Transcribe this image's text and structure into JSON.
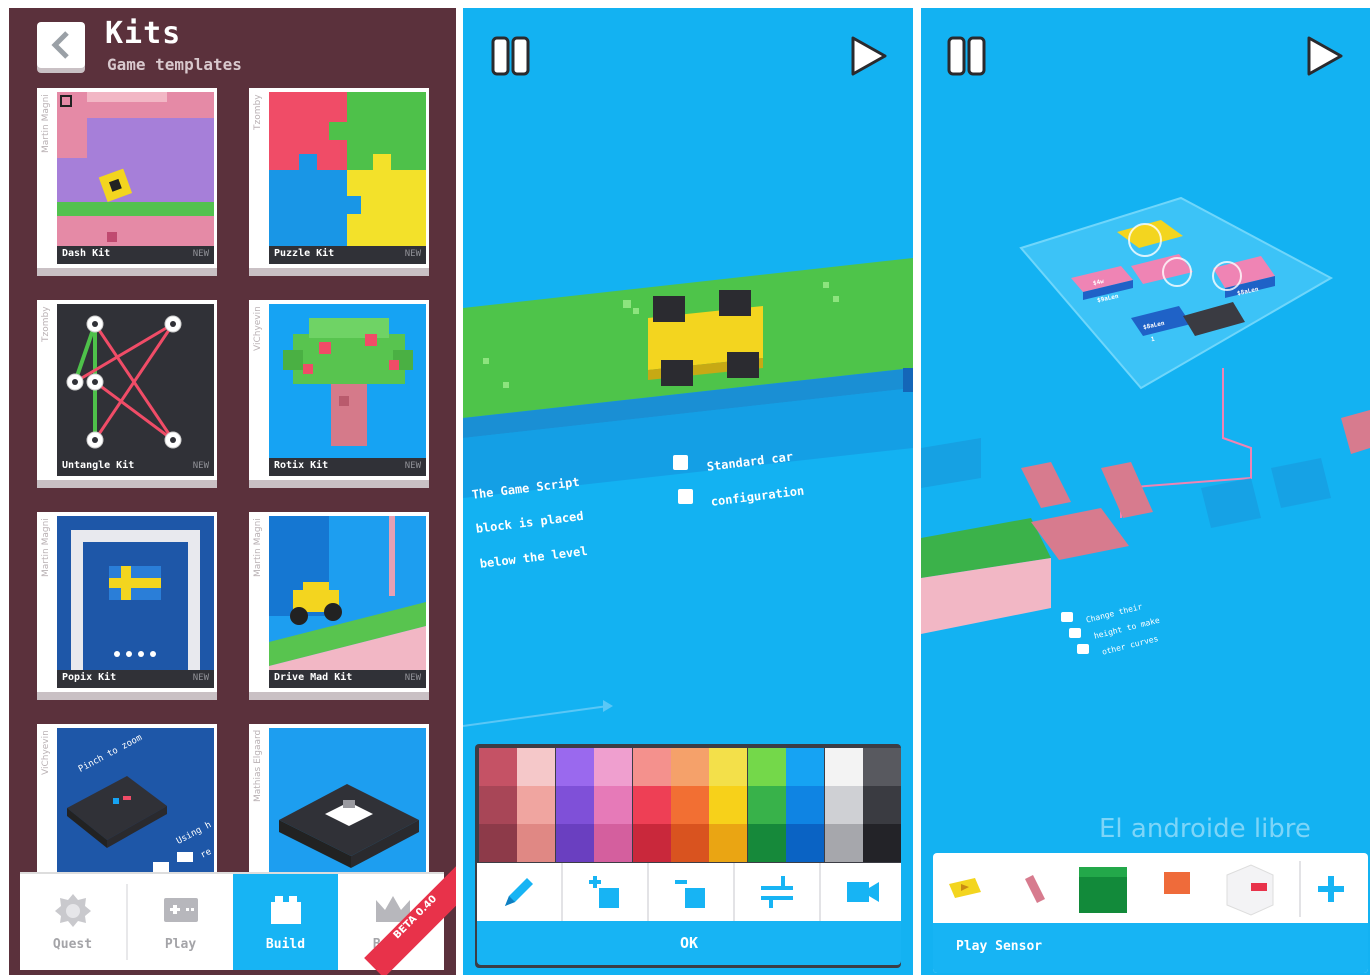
{
  "kits_screen": {
    "title": "Kits",
    "subtitle": "Game templates",
    "cards": [
      {
        "name": "Dash Kit",
        "author": "Martin Magni",
        "badge": "NEW"
      },
      {
        "name": "Puzzle Kit",
        "author": "Tzomby",
        "badge": "NEW"
      },
      {
        "name": "Untangle Kit",
        "author": "Tzomby",
        "badge": "NEW"
      },
      {
        "name": "Rotix Kit",
        "author": "ViChyevin",
        "badge": "NEW"
      },
      {
        "name": "Popix Kit",
        "author": "Martin Magni",
        "badge": "NEW"
      },
      {
        "name": "Drive Mad Kit",
        "author": "Martin Magni",
        "badge": "NEW"
      },
      {
        "name": "",
        "author": "ViChyevin",
        "badge": "",
        "overlay_text": "Pinch to zoom",
        "overlay_text_2": "Using h",
        "overlay_text_3": "re"
      },
      {
        "name": "",
        "author": "Mathias Elgaard",
        "badge": ""
      }
    ],
    "tabs": [
      {
        "label": "Quest",
        "icon": "quest-icon",
        "active": false
      },
      {
        "label": "Play",
        "icon": "gamepad-icon",
        "active": false
      },
      {
        "label": "Build",
        "icon": "block-icon",
        "active": true
      },
      {
        "label": "Boost",
        "icon": "crown-icon",
        "active": false
      }
    ],
    "beta_ribbon": "BETA 0.40"
  },
  "editor_screen": {
    "caption_left": [
      "The Game Script",
      "block is placed",
      "below the level"
    ],
    "caption_right": [
      "Standard car",
      "configuration"
    ],
    "ok_label": "OK",
    "palette_colors": [
      [
        "#c55265",
        "#f5c8c9",
        "#9a69ee",
        "#ef9fcf",
        "#f4918d",
        "#f5a16a",
        "#f3e04a",
        "#74d84a",
        "#16a3f3",
        "#f3f3f3",
        "#58595f"
      ],
      [
        "#a84657",
        "#f0a5a0",
        "#7f50d8",
        "#e67ab8",
        "#ee3f55",
        "#f26f33",
        "#f7d11a",
        "#38b24a",
        "#0f84e3",
        "#cfd0d4",
        "#3a3b41"
      ],
      [
        "#8d3a49",
        "#e08884",
        "#6a3fc0",
        "#d45f9e",
        "#c9283b",
        "#d9531f",
        "#eaa513",
        "#16893a",
        "#0a63c4",
        "#a6a7ac",
        "#232328"
      ]
    ],
    "tools": [
      "pencil-icon",
      "add-block-icon",
      "remove-block-icon",
      "swap-icon",
      "camera-icon"
    ]
  },
  "logic_screen": {
    "caption": [
      "Change their",
      "height to make",
      "other curves"
    ],
    "node_labels": [
      "$4w",
      "$9aLen",
      "$8aLen",
      "1",
      "$8aLen"
    ],
    "bottom_label": "Play Sensor",
    "watermark": "El androide libre",
    "items": [
      "play-sensor-icon",
      "pink-block-icon",
      "green-block-icon",
      "orange-block-icon",
      "white-block-icon",
      "plus-icon"
    ]
  },
  "colors": {
    "sky": "#13b2f2",
    "kits_bg": "#5b313c",
    "accent": "#17b4f4",
    "ribbon": "#e8324a"
  }
}
